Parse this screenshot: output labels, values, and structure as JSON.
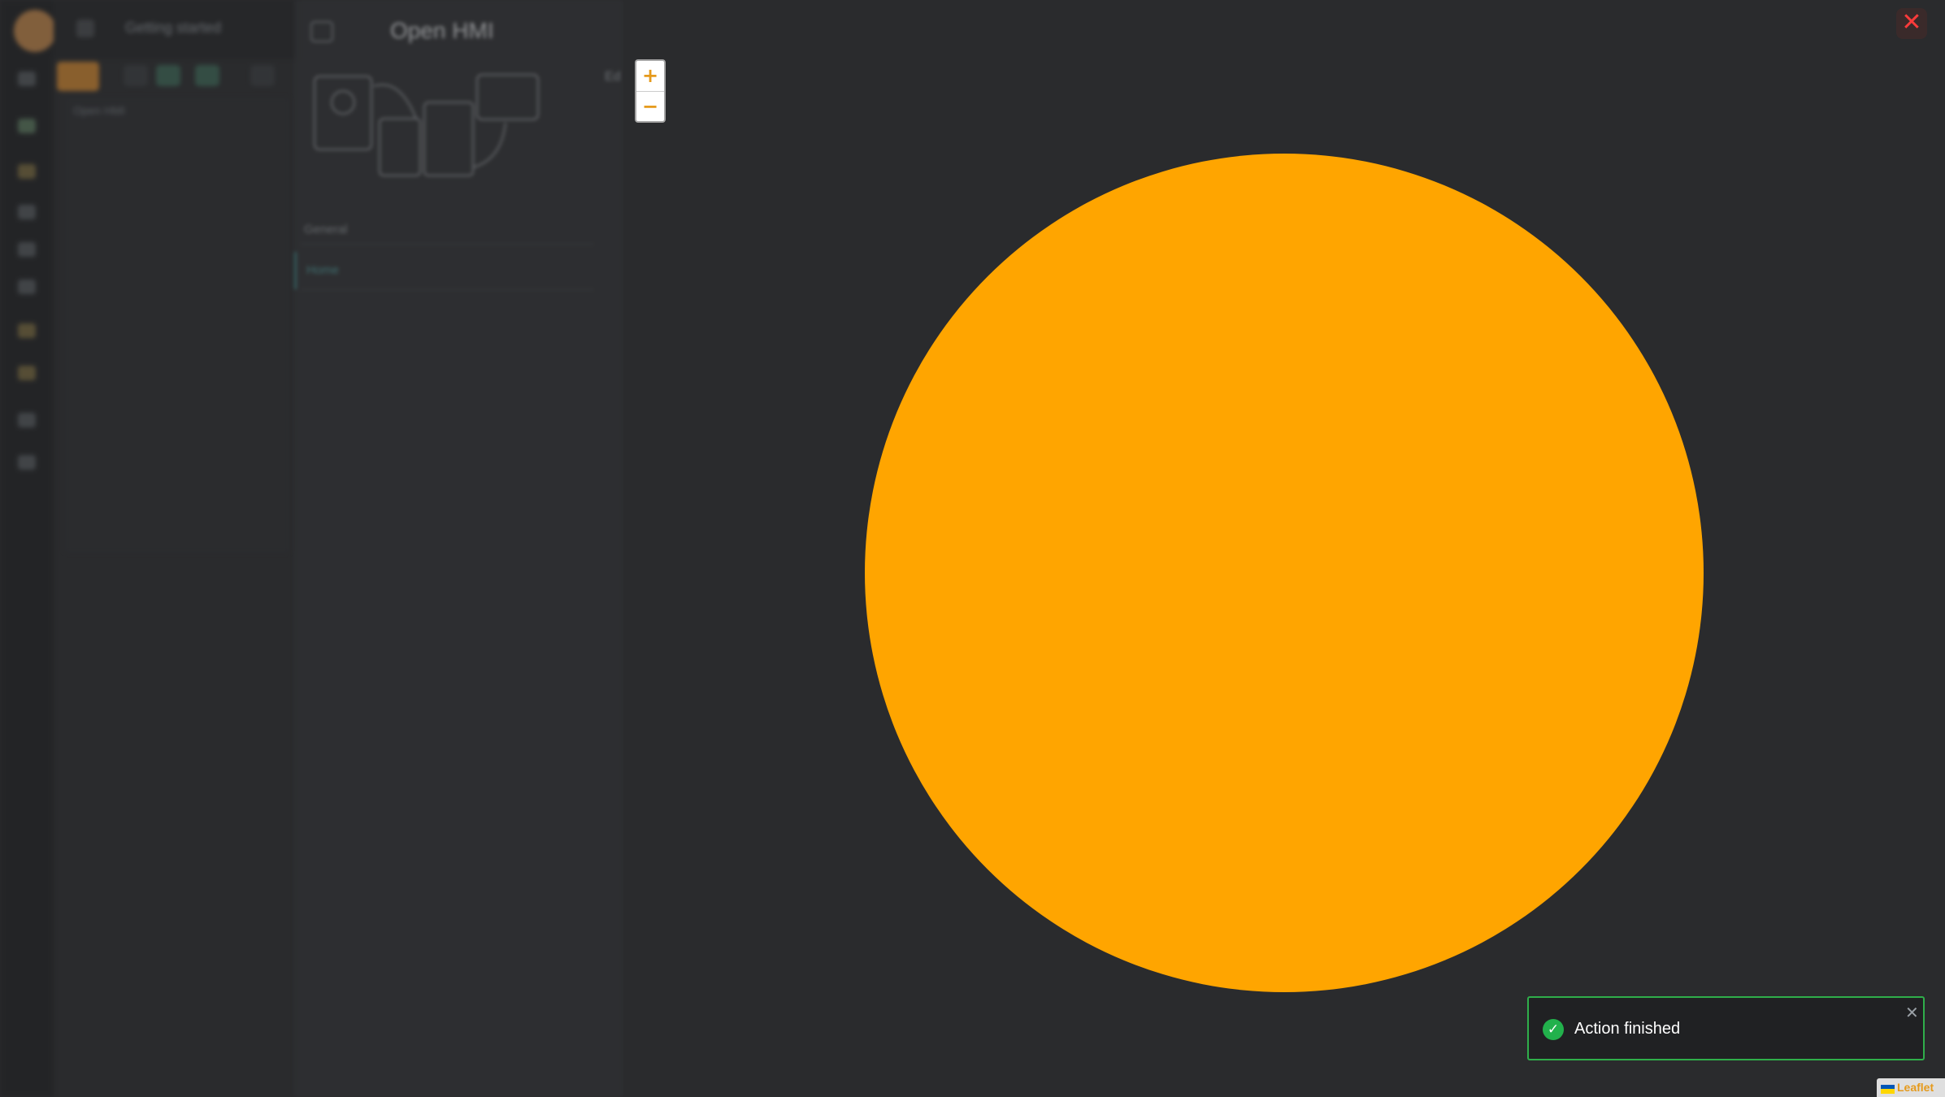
{
  "background_app": {
    "workspace_name": "Getting started",
    "list_label": "Open HMI"
  },
  "hmi_panel": {
    "title": "Open HMI",
    "section_label": "General",
    "selected_item": "Home",
    "column_head": "Ed"
  },
  "map": {
    "zoom_in_label": "+",
    "zoom_out_label": "−",
    "close_label": "✕",
    "circle_color": "#ffa500"
  },
  "toast": {
    "message": "Action finished",
    "check_symbol": "✓",
    "close_label": "✕",
    "status_color": "#22b14c"
  },
  "attribution": {
    "label": "Leaflet"
  }
}
